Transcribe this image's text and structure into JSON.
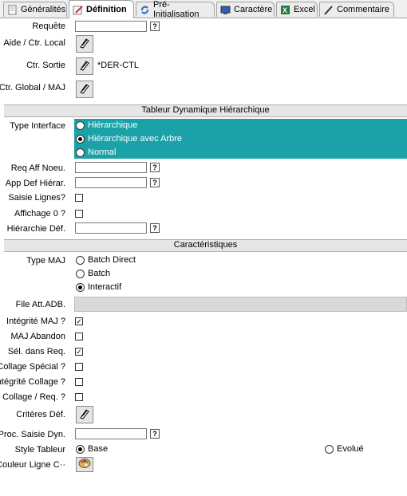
{
  "tabs": [
    {
      "label": "Généralités",
      "icon": "document-icon"
    },
    {
      "label": "Définition",
      "icon": "pencil-icon",
      "active": true
    },
    {
      "label": "Pré-Initialisation",
      "icon": "refresh-icon"
    },
    {
      "label": "Caractère",
      "icon": "monitor-icon"
    },
    {
      "label": "Excel",
      "icon": "excel-icon"
    },
    {
      "label": "Commentaire",
      "icon": "pen-icon"
    }
  ],
  "form": {
    "requete_label": "Requête",
    "aide_label": "Aide / Ctr. Local",
    "ctr_sortie_label": "Ctr. Sortie",
    "ctr_sortie_value": "*DER-CTL",
    "ctr_global_label": "Ctr. Global / MAJ",
    "help_glyph": "?"
  },
  "section1": {
    "title": "Tableur Dynamique Hiérarchique",
    "type_interface_label": "Type Interface",
    "type_interface_options": [
      "Hiérarchique",
      "Hiérarchique avec Arbre",
      "Normal"
    ],
    "type_interface_selected": "Hiérarchique avec Arbre",
    "req_aff_label": "Req Aff Noeu.",
    "app_def_label": "App Def Hiérar.",
    "saisie_lignes_label": "Saisie Lignes?",
    "affichage_label": "Affichage 0 ?",
    "hierarchie_label": "Hiérarchie Déf."
  },
  "section2": {
    "title": "Caractéristiques",
    "type_maj_label": "Type MAJ",
    "type_maj_options": [
      "Batch Direct",
      "Batch",
      "Interactif"
    ],
    "type_maj_selected": "Interactif",
    "file_att_label": "File Att.ADB.",
    "integrite_maj_label": "Intégrité MAJ ?",
    "maj_abandon_label": "MAJ Abandon",
    "sel_req_label": "Sél. dans Req.",
    "collage_special_label": "Collage Spécial ?",
    "integrite_collage_label": "Intégrité Collage ?",
    "collage_req_label": "Collage / Req. ?",
    "criteres_label": "Critères Déf.",
    "proc_saisie_label": "Proc. Saisie Dyn.",
    "style_tableur_label": "Style Tableur",
    "style_options": [
      "Base",
      "Evolué"
    ],
    "style_selected": "Base",
    "couleur_label": "Couleur Ligne C··",
    "checks": {
      "saisie_lignes": false,
      "affichage": false,
      "integrite_maj": true,
      "maj_abandon": false,
      "sel_req": true,
      "collage_special": false,
      "integrite_collage": false,
      "collage_req": false
    },
    "check_glyph": "✓"
  },
  "colors": {
    "teal": "#1ba1a8",
    "section_bg": "#e6e6e6"
  }
}
